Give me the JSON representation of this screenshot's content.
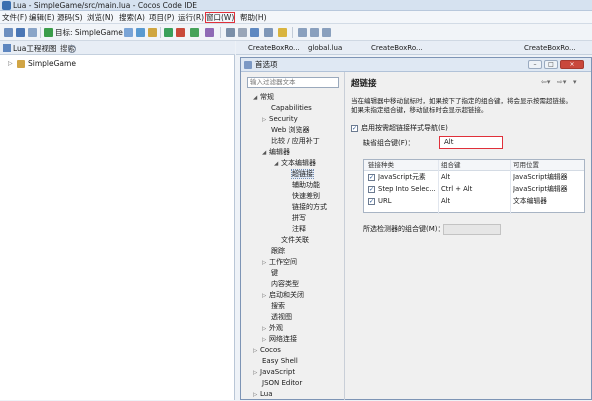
{
  "window": {
    "title": "Lua - SimpleGame/src/main.lua - Cocos Code IDE"
  },
  "menubar": {
    "items": [
      "文件(F)",
      "编辑(E)",
      "源码(S)",
      "浏览(N)",
      "搜索(A)",
      "项目(P)",
      "运行(R)",
      "窗口(W)",
      "帮助(H)"
    ]
  },
  "toolbar": {
    "target_label": "目标: SimpleGame"
  },
  "left_view": {
    "tabs": [
      "Lua工程视图",
      "搜索"
    ],
    "tree": [
      "SimpleGame"
    ]
  },
  "editor_tabs": [
    "CreateBoxRo...",
    "global.lua",
    "CreateBoxRo...",
    "CreateBoxRo..."
  ],
  "dialog": {
    "title": "首选项",
    "filter_placeholder": "输入过滤器文本",
    "tree": [
      {
        "label": "常规",
        "arrow": "◢"
      },
      {
        "label": "Capabilities",
        "arrow": ""
      },
      {
        "label": "Security",
        "arrow": "▷"
      },
      {
        "label": "Web 浏览器",
        "arrow": ""
      },
      {
        "label": "比较 / 应用补丁",
        "arrow": ""
      },
      {
        "label": "编辑器",
        "arrow": "◢"
      },
      {
        "label": "文本编辑器",
        "arrow": "◢"
      },
      {
        "label": "超链接",
        "arrow": ""
      },
      {
        "label": "辅助功能",
        "arrow": ""
      },
      {
        "label": "快速差别",
        "arrow": ""
      },
      {
        "label": "链接的方式",
        "arrow": ""
      },
      {
        "label": "拼写",
        "arrow": ""
      },
      {
        "label": "注释",
        "arrow": ""
      },
      {
        "label": "文件关联",
        "arrow": ""
      },
      {
        "label": "跟踪",
        "arrow": ""
      },
      {
        "label": "工作空间",
        "arrow": "▷"
      },
      {
        "label": "键",
        "arrow": ""
      },
      {
        "label": "内容类型",
        "arrow": ""
      },
      {
        "label": "启动和关闭",
        "arrow": "▷"
      },
      {
        "label": "搜索",
        "arrow": ""
      },
      {
        "label": "透视图",
        "arrow": ""
      },
      {
        "label": "外观",
        "arrow": "▷"
      },
      {
        "label": "网络连接",
        "arrow": "▷"
      },
      {
        "label": "Cocos",
        "arrow": "▷"
      },
      {
        "label": "Easy Shell",
        "arrow": ""
      },
      {
        "label": "JavaScript",
        "arrow": "▷"
      },
      {
        "label": "JSON Editor",
        "arrow": ""
      },
      {
        "label": "Lua",
        "arrow": "▷"
      }
    ],
    "pane": {
      "title": "超链接",
      "desc_line1": "当在编辑器中移动鼠标时，如果按下了指定的组合键，将会显示按需超链接。",
      "desc_line2": "如果未指定组合键，移动鼠标时会显示超链接。",
      "enable_checkbox_label": "启用按需超链接样式导航(E)",
      "enable_checked": true,
      "modifier_label": "缺省组合键(F)：",
      "modifier_value": "Alt",
      "table": {
        "headers": [
          "链接种类",
          "组合键",
          "可用位置"
        ],
        "rows": [
          {
            "checked": true,
            "kind": "JavaScript元素",
            "key": "Alt",
            "scope": "JavaScript编辑器"
          },
          {
            "checked": true,
            "kind": "Step Into Selec...",
            "key": "Ctrl + Alt",
            "scope": "JavaScript编辑器"
          },
          {
            "checked": true,
            "kind": "URL",
            "key": "Alt",
            "scope": "文本编辑器"
          }
        ]
      },
      "detected_label": "所选检测器的组合键(M)："
    }
  },
  "colors": {
    "highlight_outline": "#e0303a",
    "selection": "#dfe9f7"
  }
}
